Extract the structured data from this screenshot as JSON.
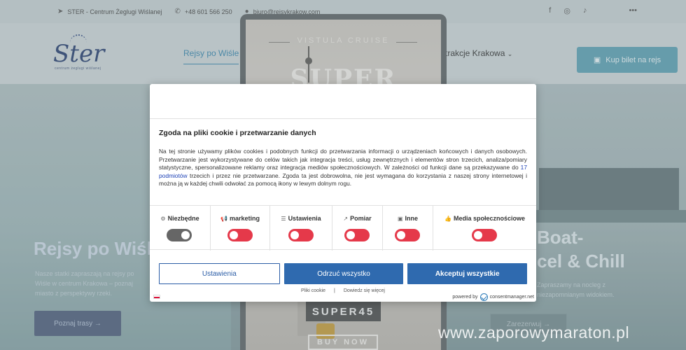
{
  "topbar": {
    "address": "STER - Centrum Żeglugi Wiślanej",
    "phone": "+48 601 566 250",
    "email": "biuro@rejsykrakow.com",
    "social": [
      "facebook",
      "instagram",
      "tiktok"
    ],
    "more": "•••"
  },
  "navbar": {
    "logo": "Ster",
    "logo_sub": "centrum żeglugi wiślanej",
    "nav_item_1": "Rejsy po Wiśle",
    "nav_item_2": "Atrakcje Krakowa",
    "buy_ticket": "Kup bilet na rejs"
  },
  "hero": {
    "left_title": "Rejsy po Wiśle",
    "left_text": "Nasze statki zapraszają na rejsy po Wiśle w centrum Krakowa – poznaj miasto z perspektywy rzeki.",
    "left_button": "Poznaj trasy",
    "right_title_1": "Boat-",
    "right_title_2": "cel & Chill",
    "right_text": "Zapraszamy na nocleg z niezapomnianym widokiem.",
    "right_button": "Zarezerwuj"
  },
  "poster": {
    "subtitle": "VISTULA CRUISE",
    "big": "SUPER",
    "badge": "SUPER45",
    "buy": "BUY NOW"
  },
  "cookie": {
    "title": "Zgoda na pliki cookie i przetwarzanie danych",
    "text_before": "Na tej stronie używamy plików cookies i podobnych funkcji do przetwarzania informacji o urządzeniach końcowych i danych osobowych. Przetwarzanie jest wykorzystywane do celów takich jak integracja treści, usług zewnętrznych i elementów stron trzecich, analiza/pomiary statystyczne, spersonalizowane reklamy oraz integracja mediów społecznościowych. W zależności od funkcji dane są przekazywane do ",
    "link": "17 podmiotów",
    "text_after": " trzecich i przez nie przetwarzane. Zgoda ta jest dobrowolna, nie jest wymagana do korzystania z naszej strony internetowej i można ją w każdej chwili odwołać za pomocą ikony w lewym dolnym rogu.",
    "categories": [
      {
        "label": "Niezbędne",
        "icon": "⚙",
        "state": "locked"
      },
      {
        "label": "marketing",
        "icon": "📢",
        "state": "off"
      },
      {
        "label": "Ustawienia",
        "icon": "☰",
        "state": "off"
      },
      {
        "label": "Pomiar",
        "icon": "↗",
        "state": "off"
      },
      {
        "label": "Inne",
        "icon": "▣",
        "state": "off"
      },
      {
        "label": "Media społecznościowe",
        "icon": "👍",
        "state": "off"
      }
    ],
    "btn_settings": "Ustawienia",
    "btn_reject": "Odrzuć wszystko",
    "btn_accept": "Akceptuj wszystkie",
    "link_cookies": "Pliki cookie",
    "link_sep": "|",
    "link_more": "Dowiedz się więcej",
    "powered_by": "powered by",
    "brand": "consentmanager.net"
  },
  "watermark": "www.zaporowymaraton.pl"
}
